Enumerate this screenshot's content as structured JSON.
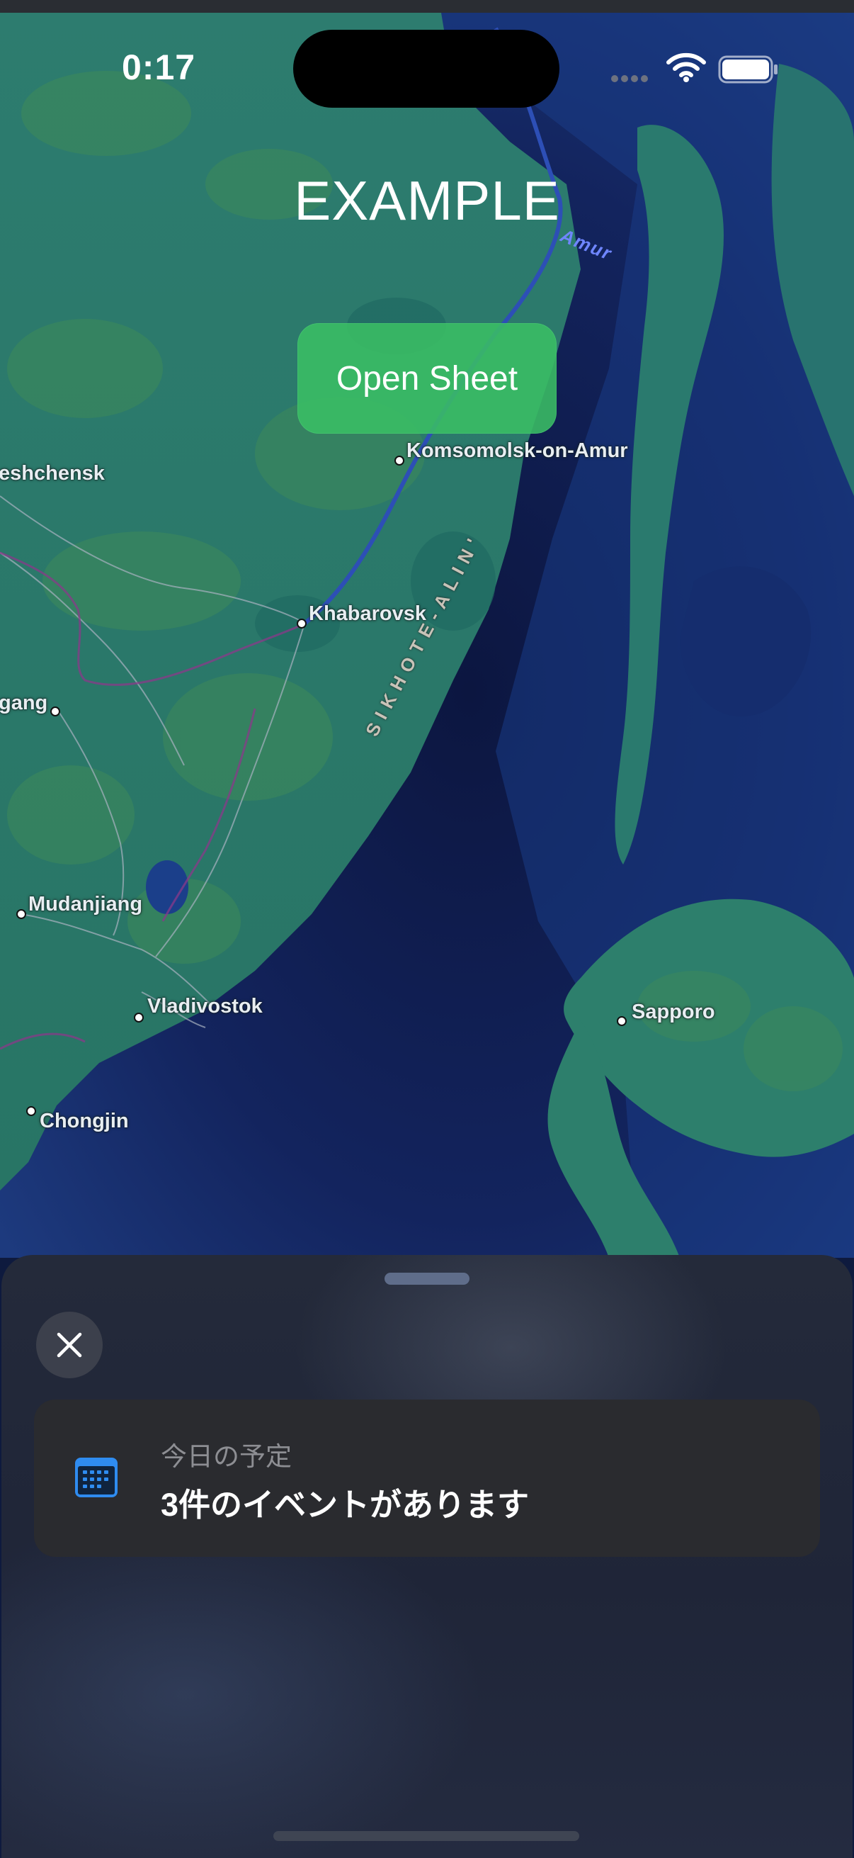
{
  "status_bar": {
    "time": "0:17"
  },
  "app": {
    "title": "EXAMPLE",
    "open_sheet_label": "Open Sheet"
  },
  "map": {
    "cities": [
      "Komsomolsk-on-Amur",
      "eshchensk",
      "Khabarovsk",
      "gang",
      "Mudanjiang",
      "Vladivostok",
      "Chongjin",
      "Sapporo"
    ],
    "mountain_range": "SIKHOTE-ALIN'",
    "river": "Amur"
  },
  "sheet": {
    "card": {
      "subtitle": "今日の予定",
      "title": "3件のイベントがあります",
      "icon": "calendar-icon"
    }
  },
  "colors": {
    "accent_green": "#3abe64",
    "calendar_blue": "#2f8cf0",
    "sea": "#0f1c4a",
    "land": "#2a7a6e"
  }
}
